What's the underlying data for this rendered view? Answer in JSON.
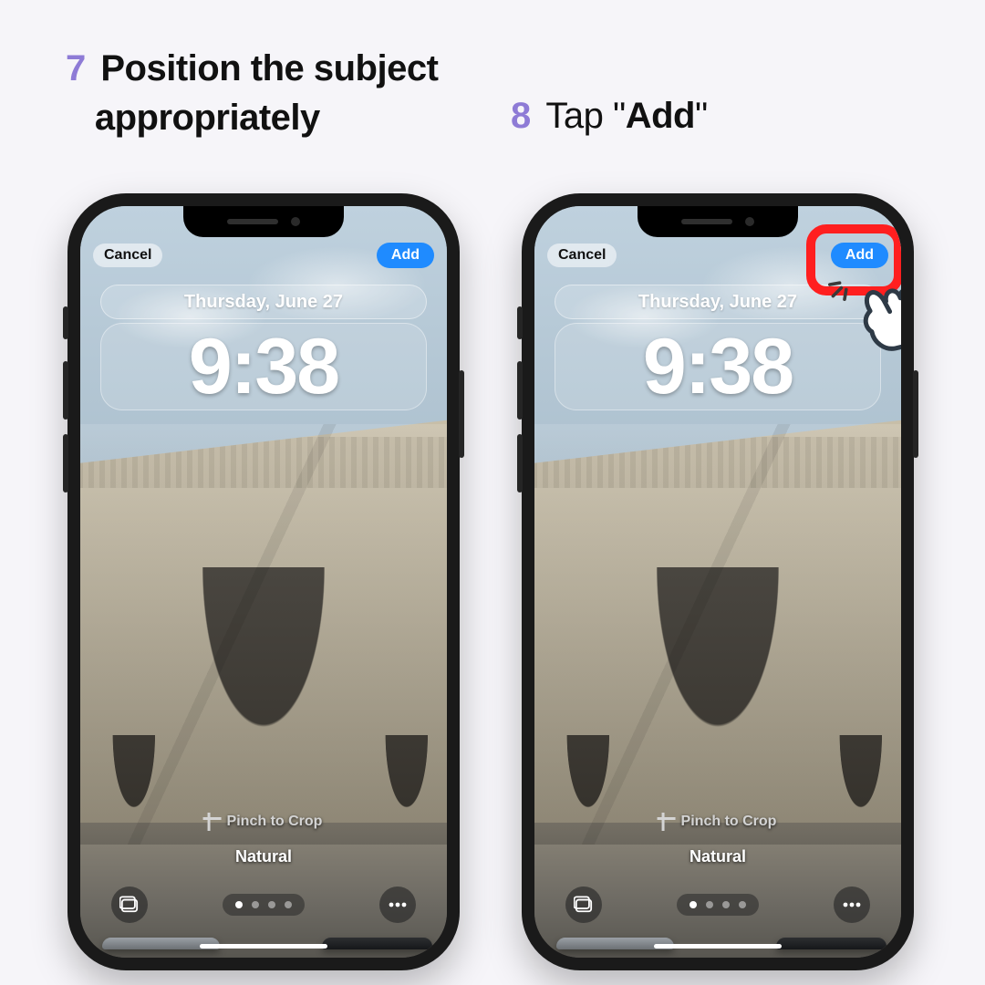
{
  "steps": {
    "s7": {
      "num": "7",
      "line1": "Position the subject",
      "line2": "appropriately"
    },
    "s8": {
      "num": "8",
      "prefix": "Tap ",
      "q1": "\"",
      "bold": "Add",
      "q2": "\""
    }
  },
  "phone": {
    "cancel": "Cancel",
    "add": "Add",
    "date": "Thursday, June 27",
    "time": "9:38",
    "pinch": "Pinch to Crop",
    "filter": "Natural"
  }
}
